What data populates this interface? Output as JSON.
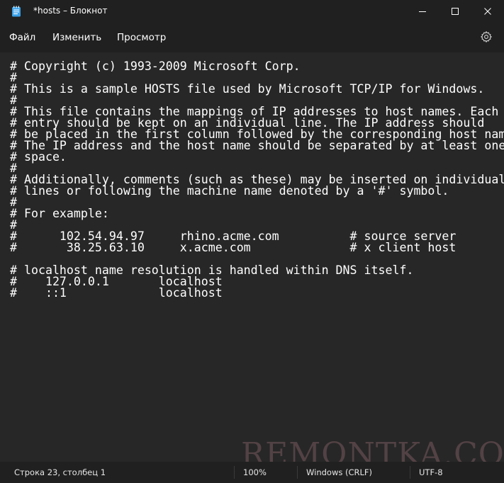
{
  "window": {
    "title": "*hosts – Блокнот",
    "icons": {
      "app": "notepad-icon",
      "minimize": "minimize-icon",
      "maximize": "maximize-icon",
      "close": "close-icon"
    }
  },
  "menu": {
    "items": [
      "Файл",
      "Изменить",
      "Просмотр"
    ],
    "settings_icon": "gear-icon"
  },
  "editor": {
    "content": "# Copyright (c) 1993-2009 Microsoft Corp.\n#\n# This is a sample HOSTS file used by Microsoft TCP/IP for Windows.\n#\n# This file contains the mappings of IP addresses to host names. Each\n# entry should be kept on an individual line. The IP address should\n# be placed in the first column followed by the corresponding host name.\n# The IP address and the host name should be separated by at least one\n# space.\n#\n# Additionally, comments (such as these) may be inserted on individual\n# lines or following the machine name denoted by a '#' symbol.\n#\n# For example:\n#\n#      102.54.94.97     rhino.acme.com          # source server\n#       38.25.63.10     x.acme.com              # x client host\n\n# localhost name resolution is handled within DNS itself.\n#    127.0.0.1       localhost\n#    ::1             localhost"
  },
  "status": {
    "position": "Строка 23, столбец 1",
    "zoom": "100%",
    "line_endings": "Windows (CRLF)",
    "encoding": "UTF-8"
  },
  "watermark": "REMONTKA.COM",
  "colors": {
    "titlebar_bg": "#202020",
    "editor_bg": "#272727",
    "text": "#ffffff",
    "accent_icon": "#4cc2ff"
  }
}
